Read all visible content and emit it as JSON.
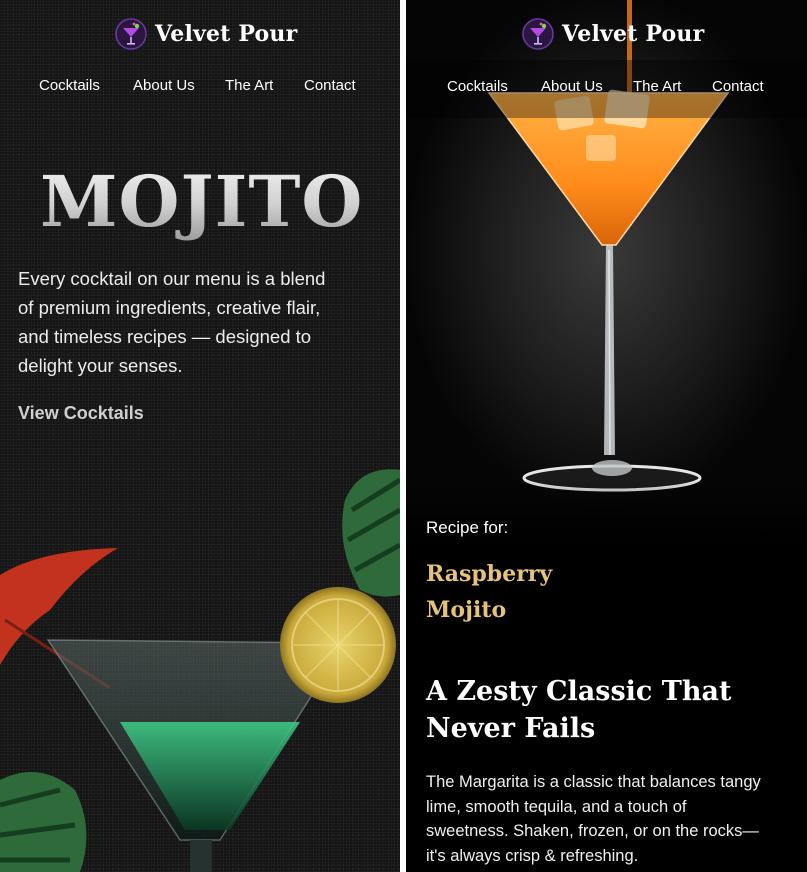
{
  "brand": {
    "name": "Velvet Pour",
    "logo_icon": "martini-logo-icon"
  },
  "nav": {
    "items": [
      {
        "label": "Cocktails"
      },
      {
        "label": "About Us"
      },
      {
        "label": "The Art"
      },
      {
        "label": "Contact"
      }
    ]
  },
  "hero": {
    "title": "MOJITO",
    "description": "Every cocktail on our menu is a blend of premium ingredients, creative flair, and timeless recipes — designed to delight your senses.",
    "cta_label": "View Cocktails"
  },
  "recipe": {
    "prefix": "Recipe for:",
    "name": "Raspberry Mojito",
    "heading": "A Zesty Classic That Never Fails",
    "body": "The Margarita is a classic that balances tangy lime, smooth tequila, and a touch of sweetness. Shaken, frozen, or on the rocks—it's always crisp & refreshing."
  },
  "colors": {
    "accent_gold": "#e6c27a",
    "background_dark": "#141414",
    "text_primary": "#ffffff"
  }
}
